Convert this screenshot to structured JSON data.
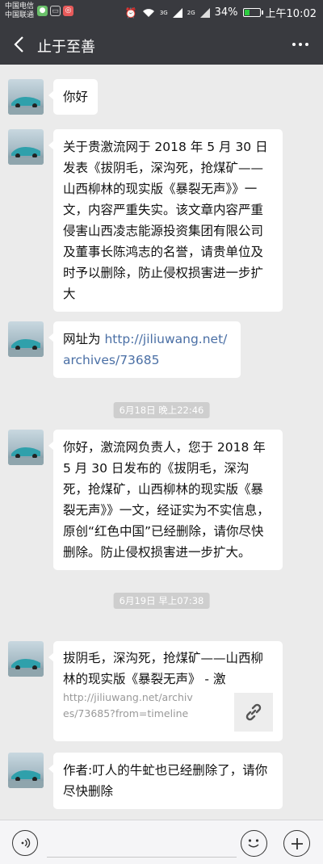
{
  "status_bar": {
    "carrier_1": "中国电信",
    "carrier_2": "中国联通",
    "network_1": "3G",
    "network_2": "2G",
    "battery": "34%",
    "battery_level": 0.34,
    "time": "上午10:02",
    "icons": [
      "wechat-icon",
      "cast-icon",
      "notification-app-icon",
      "alarm-icon",
      "wifi-icon",
      "signal-icon",
      "battery-icon"
    ]
  },
  "nav": {
    "title": "止于至善",
    "back_icon": "chevron-left-icon",
    "more_icon": "more-dots-icon"
  },
  "messages": [
    {
      "type": "text",
      "text": "你好"
    },
    {
      "type": "text",
      "text": "关于贵激流网于 2018 年 5 月 30 日发表《拔阴毛，深沟死，抢煤矿——山西柳林的现实版《暴裂无声》》一文，内容严重失实。该文章内容严重侵害山西凌志能源投资集团有限公司及董事长陈鸿志的名誉，请贵单位及时予以删除，防止侵权损害进一步扩大"
    },
    {
      "type": "link",
      "prefix": "网址为 ",
      "url": "http://jiliuwang.net/archives/73685"
    },
    {
      "type": "time",
      "text": "6月18日 晚上22:46"
    },
    {
      "type": "text",
      "text": "你好，激流网负责人，您于 2018 年 5 月 30 日发布的《拔阴毛，深沟死，抢煤矿，山西柳林的现实版《暴裂无声》》一文，经证实为不实信息，原创“红色中国”已经删除，请你尽快删除。防止侵权损害进一步扩大。"
    },
    {
      "type": "time",
      "text": "6月19日 早上07:38"
    },
    {
      "type": "share",
      "title": "拔阴毛，深沟死，抢煤矿——山西柳林的现实版《暴裂无声》 - 激",
      "url": "http://jiliuwang.net/archives/73685?from=timeline",
      "thumb_icon": "link-icon"
    },
    {
      "type": "text",
      "text": "作者:叮人的牛虻也已经删除了，请你尽快删除"
    }
  ],
  "input_bar": {
    "voice_icon": "voice-icon",
    "input_value": "",
    "emoji_icon": "emoji-icon",
    "plus_icon": "plus-icon"
  }
}
